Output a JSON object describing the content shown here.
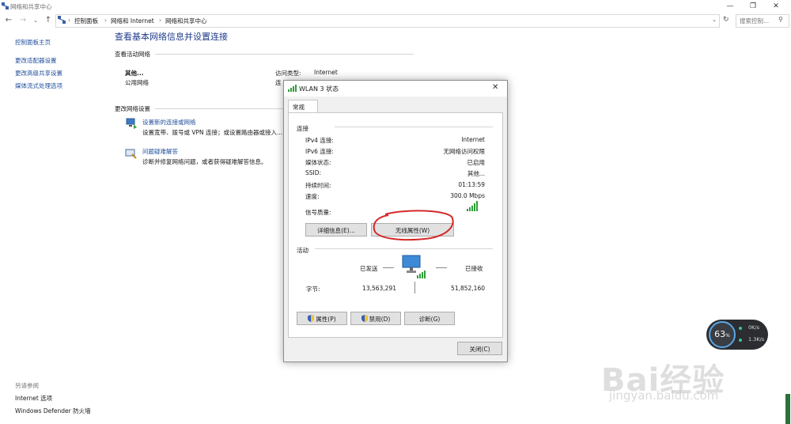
{
  "window": {
    "title": "网络和共享中心"
  },
  "address": {
    "crumbs": [
      "控制面板",
      "网络和 Internet",
      "网络和共享中心"
    ],
    "search_placeholder": "搜索控制..."
  },
  "sidebar": {
    "items": [
      {
        "label": "控制面板主页"
      },
      {
        "label": "更改适配器设置"
      },
      {
        "label": "更改高级共享设置"
      },
      {
        "label": "媒体流式处理选项"
      }
    ],
    "see_also_label": "另请参阅",
    "see_also": [
      {
        "label": "Internet 选项"
      },
      {
        "label": "Windows Defender 防火墙"
      }
    ]
  },
  "main": {
    "title": "查看基本网络信息并设置连接",
    "active_section": "查看活动网络",
    "network_name": "其他...",
    "network_type": "公用网络",
    "access_type_label": "访问类型:",
    "access_type_value": "Internet",
    "conn_label_partial": "连",
    "change_section": "更改网络设置",
    "tasks": [
      {
        "title": "设置新的连接或网络",
        "desc": "设置宽带、拨号或 VPN 连接；或设置路由器或接入..."
      },
      {
        "title": "问题疑难解答",
        "desc": "诊断并修复网络问题，或者获得疑难解答信息。"
      }
    ]
  },
  "dialog": {
    "title": "WLAN 3 状态",
    "tab": "常规",
    "connection_group": "连接",
    "rows": [
      {
        "label": "IPv4 连接:",
        "value": "Internet"
      },
      {
        "label": "IPv6 连接:",
        "value": "无网络访问权限"
      },
      {
        "label": "媒体状态:",
        "value": "已启用"
      },
      {
        "label": "SSID:",
        "value": "其他..."
      },
      {
        "label": "持续时间:",
        "value": "01:13:59"
      },
      {
        "label": "速度:",
        "value": "300.0 Mbps"
      }
    ],
    "signal_label": "信号质量:",
    "details_button": "详细信息(E)...",
    "wireless_button": "无线属性(W)",
    "activity_group": "活动",
    "sent_label": "已发送",
    "received_label": "已接收",
    "bytes_label": "字节:",
    "bytes_sent": "13,563,291",
    "bytes_received": "51,852,160",
    "properties_button": "属性(P)",
    "disable_button": "禁用(D)",
    "diagnose_button": "诊断(G)",
    "close_button": "关闭(C)"
  },
  "widget": {
    "percent": "63",
    "percent_unit": "%",
    "up": "0K/s",
    "down": "1.3K/s"
  },
  "watermark": {
    "main": "Bai经验",
    "sub": "jingyan.baidu.com"
  }
}
